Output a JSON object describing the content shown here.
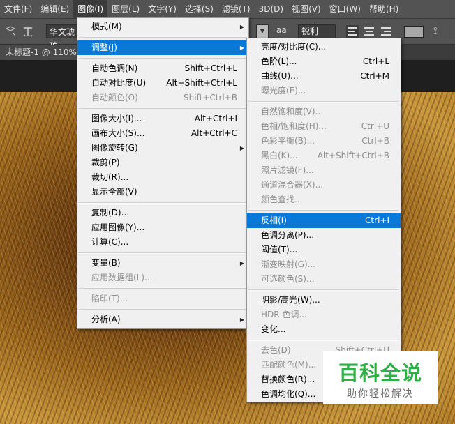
{
  "menubar": [
    {
      "label": "文件(F)",
      "active": false
    },
    {
      "label": "编辑(E)",
      "active": false
    },
    {
      "label": "图像(I)",
      "active": true
    },
    {
      "label": "图层(L)",
      "active": false
    },
    {
      "label": "文字(Y)",
      "active": false
    },
    {
      "label": "选择(S)",
      "active": false
    },
    {
      "label": "滤镜(T)",
      "active": false
    },
    {
      "label": "3D(D)",
      "active": false
    },
    {
      "label": "视图(V)",
      "active": false
    },
    {
      "label": "窗口(W)",
      "active": false
    },
    {
      "label": "帮助(H)",
      "active": false
    }
  ],
  "optbar": {
    "font": "华文琥珀",
    "antialias_label": "aa",
    "antialias": "锐利",
    "icons": [
      "text-orientation-icon",
      "align-left-icon",
      "align-center-icon",
      "align-right-icon",
      "warp-text-icon"
    ]
  },
  "document": {
    "tab": "未标题-1 @ 110%"
  },
  "image_menu": [
    {
      "label": "模式(M)",
      "shortcut": "",
      "arrow": true,
      "enabled": true
    },
    {
      "sep": true
    },
    {
      "label": "调整(J)",
      "shortcut": "",
      "arrow": true,
      "enabled": true,
      "highlight": true
    },
    {
      "sep": true
    },
    {
      "label": "自动色调(N)",
      "shortcut": "Shift+Ctrl+L",
      "enabled": true
    },
    {
      "label": "自动对比度(U)",
      "shortcut": "Alt+Shift+Ctrl+L",
      "enabled": true
    },
    {
      "label": "自动颜色(O)",
      "shortcut": "Shift+Ctrl+B",
      "enabled": false
    },
    {
      "sep": true
    },
    {
      "label": "图像大小(I)...",
      "shortcut": "Alt+Ctrl+I",
      "enabled": true
    },
    {
      "label": "画布大小(S)...",
      "shortcut": "Alt+Ctrl+C",
      "enabled": true
    },
    {
      "label": "图像旋转(G)",
      "shortcut": "",
      "arrow": true,
      "enabled": true
    },
    {
      "label": "裁剪(P)",
      "shortcut": "",
      "enabled": true
    },
    {
      "label": "裁切(R)...",
      "shortcut": "",
      "enabled": true
    },
    {
      "label": "显示全部(V)",
      "shortcut": "",
      "enabled": true
    },
    {
      "sep": true
    },
    {
      "label": "复制(D)...",
      "shortcut": "",
      "enabled": true
    },
    {
      "label": "应用图像(Y)...",
      "shortcut": "",
      "enabled": true
    },
    {
      "label": "计算(C)...",
      "shortcut": "",
      "enabled": true
    },
    {
      "sep": true
    },
    {
      "label": "变量(B)",
      "shortcut": "",
      "arrow": true,
      "enabled": true
    },
    {
      "label": "应用数据组(L)...",
      "shortcut": "",
      "enabled": false
    },
    {
      "sep": true
    },
    {
      "label": "陷印(T)...",
      "shortcut": "",
      "enabled": false
    },
    {
      "sep": true
    },
    {
      "label": "分析(A)",
      "shortcut": "",
      "arrow": true,
      "enabled": true
    }
  ],
  "adjust_menu": [
    {
      "label": "亮度/对比度(C)...",
      "shortcut": "",
      "enabled": true
    },
    {
      "label": "色阶(L)...",
      "shortcut": "Ctrl+L",
      "enabled": true
    },
    {
      "label": "曲线(U)...",
      "shortcut": "Ctrl+M",
      "enabled": true
    },
    {
      "label": "曝光度(E)...",
      "shortcut": "",
      "enabled": false
    },
    {
      "sep": true
    },
    {
      "label": "自然饱和度(V)...",
      "shortcut": "",
      "enabled": false
    },
    {
      "label": "色相/饱和度(H)...",
      "shortcut": "Ctrl+U",
      "enabled": false
    },
    {
      "label": "色彩平衡(B)...",
      "shortcut": "Ctrl+B",
      "enabled": false
    },
    {
      "label": "黑白(K)...",
      "shortcut": "Alt+Shift+Ctrl+B",
      "enabled": false
    },
    {
      "label": "照片滤镜(F)...",
      "shortcut": "",
      "enabled": false
    },
    {
      "label": "通道混合器(X)...",
      "shortcut": "",
      "enabled": false
    },
    {
      "label": "颜色查找...",
      "shortcut": "",
      "enabled": false
    },
    {
      "sep": true
    },
    {
      "label": "反相(I)",
      "shortcut": "Ctrl+I",
      "enabled": true,
      "highlight": true
    },
    {
      "label": "色调分离(P)...",
      "shortcut": "",
      "enabled": true
    },
    {
      "label": "阈值(T)...",
      "shortcut": "",
      "enabled": true
    },
    {
      "label": "渐变映射(G)...",
      "shortcut": "",
      "enabled": false
    },
    {
      "label": "可选颜色(S)...",
      "shortcut": "",
      "enabled": false
    },
    {
      "sep": true
    },
    {
      "label": "阴影/高光(W)...",
      "shortcut": "",
      "enabled": true
    },
    {
      "label": "HDR 色调...",
      "shortcut": "",
      "enabled": false
    },
    {
      "label": "变化...",
      "shortcut": "",
      "enabled": true
    },
    {
      "sep": true
    },
    {
      "label": "去色(D)",
      "shortcut": "Shift+Ctrl+U",
      "enabled": false
    },
    {
      "label": "匹配颜色(M)...",
      "shortcut": "",
      "enabled": false
    },
    {
      "label": "替换颜色(R)...",
      "shortcut": "",
      "enabled": true
    },
    {
      "label": "色调均化(Q)...",
      "shortcut": "",
      "enabled": true
    }
  ],
  "watermark": {
    "title": "百科全说",
    "subtitle": "助你轻松解决"
  }
}
